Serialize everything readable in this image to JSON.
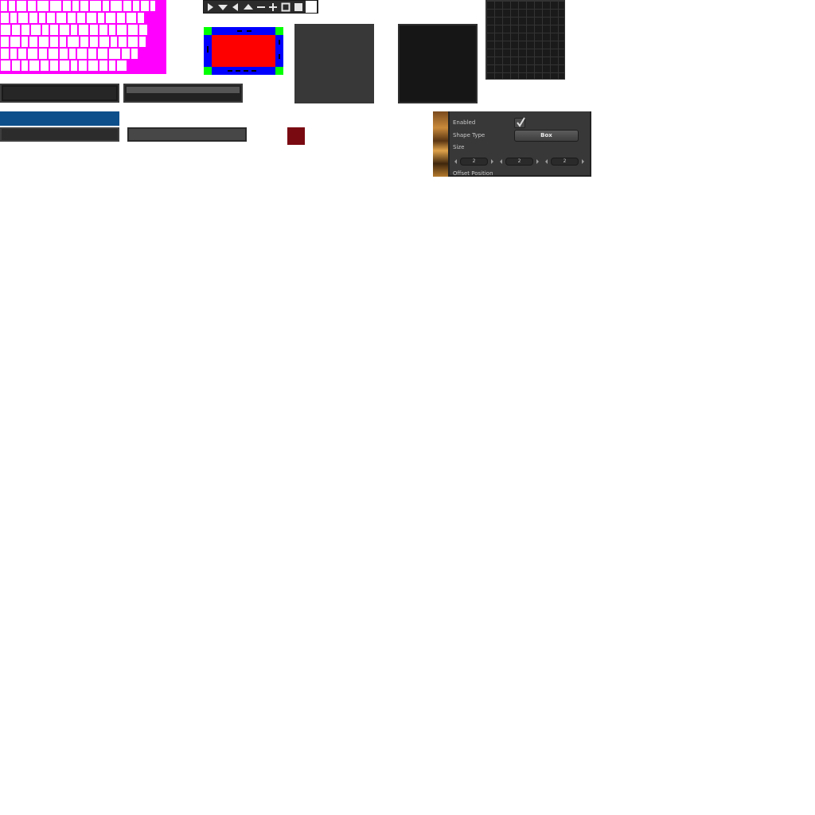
{
  "atlas": {
    "bg_color": "#ff00ff",
    "cell_color": "#ffffff"
  },
  "icon_strip": {
    "icons": [
      "play-right-icon",
      "triangle-down-icon",
      "triangle-left-icon",
      "triangle-up-icon",
      "minus-icon",
      "plus-icon",
      "square-outline-icon",
      "square-filled-icon",
      "white-box-icon"
    ]
  },
  "colors": {
    "nine_slice_border": "#0000ff",
    "nine_slice_corner": "#00ff00",
    "nine_slice_center": "#ff0000",
    "blue_bar": "#0d4f8b",
    "red_swatch": "#7a0a12"
  },
  "inspector": {
    "enabled_label": "Enabled",
    "enabled_checked": true,
    "shape_type_label": "Shape Type",
    "shape_type_value": "Box",
    "size_label": "Size",
    "size_x": "2",
    "size_y": "2",
    "size_z": "2",
    "offset_label": "Offset Position"
  }
}
